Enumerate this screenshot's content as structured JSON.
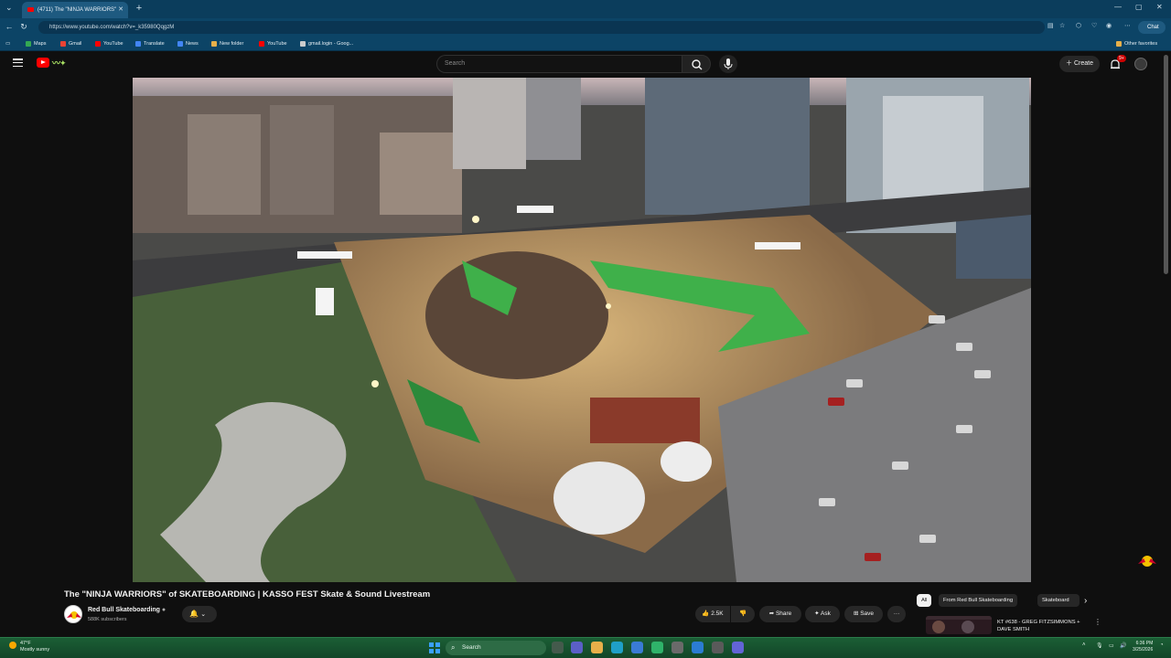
{
  "browser": {
    "tab_title": "(4711) The \"NINJA WARRIORS\"",
    "new_tab_icon": "+",
    "url": "https://www.youtube.com/watch?v=_k35980QqgzM",
    "chat_label": "Chat",
    "bookmarks": [
      {
        "label": "Maps",
        "color": "#34a853"
      },
      {
        "label": "Gmail",
        "color": "#ea4335"
      },
      {
        "label": "YouTube",
        "color": "#ff0000"
      },
      {
        "label": "Translate",
        "color": "#4285f4"
      },
      {
        "label": "News",
        "color": "#4285f4"
      },
      {
        "label": "New folder",
        "color": "#e8b04a"
      },
      {
        "label": "YouTube",
        "color": "#ff0000"
      },
      {
        "label": "gmail.login - Goog...",
        "color": "#cccccc"
      }
    ],
    "other_favorites": "Other favorites"
  },
  "masthead": {
    "search_placeholder": "Search",
    "create_label": "Create",
    "notification_count": "9+"
  },
  "video": {
    "title": "The \"NINJA WARRIORS\" of SKATEBOARDING | KASSO FEST Skate & Sound Livestream",
    "channel_name": "Red Bull Skateboarding",
    "subscribers": "588K subscribers",
    "like_count": "2.5K",
    "share_label": "Share",
    "ask_label": "Ask",
    "save_label": "Save",
    "more_label": "···"
  },
  "sidebar": {
    "chips": [
      "All",
      "From Red Bull Skateboarding",
      "Skateboard"
    ],
    "recommendation_title": "KT #638 - GREG FITZSIMMONS + DAVE SMITH"
  },
  "taskbar": {
    "temperature": "47°F",
    "weather_desc": "Mostly sunny",
    "search_label": "Search",
    "time": "6:36 PM",
    "date": "3/25/2026"
  },
  "colors": {
    "yt_red": "#ff0000",
    "bg": "#0f0f0f",
    "browser_chrome": "#0c4466",
    "taskbar": "#1b5e35"
  }
}
